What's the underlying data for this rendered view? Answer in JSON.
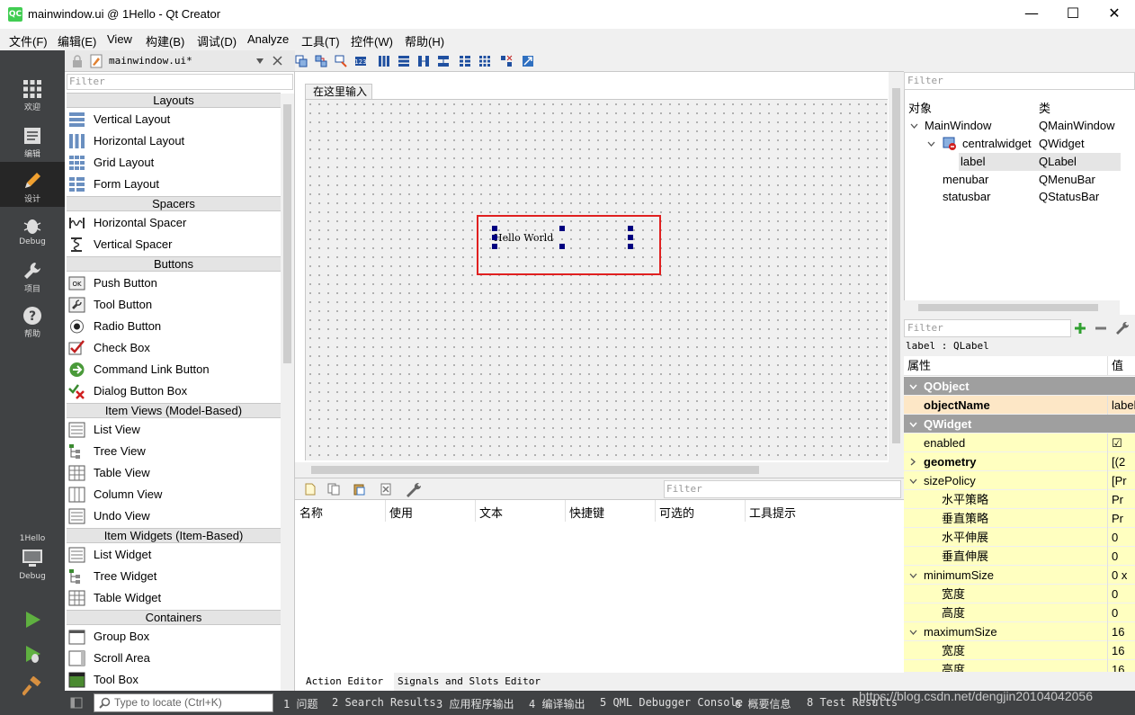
{
  "window": {
    "app_icon": "QC",
    "title": "mainwindow.ui @ 1Hello - Qt Creator",
    "minimize": "—",
    "maximize": "☐",
    "close": "✕"
  },
  "menu": [
    "文件(F)",
    "编辑(E)",
    "View",
    "构建(B)",
    "调试(D)",
    "Analyze",
    "工具(T)",
    "控件(W)",
    "帮助(H)"
  ],
  "modes": [
    {
      "label": "欢迎",
      "icon": "grid-icon"
    },
    {
      "label": "编辑",
      "icon": "document-icon"
    },
    {
      "label": "设计",
      "icon": "pencil-icon"
    },
    {
      "label": "Debug",
      "icon": "bug-icon"
    },
    {
      "label": "项目",
      "icon": "wrench-icon"
    },
    {
      "label": "帮助",
      "icon": "help-icon"
    }
  ],
  "kit": {
    "project": "1Hello",
    "config": "Debug"
  },
  "file_toolbar": {
    "filename": "mainwindow.ui*"
  },
  "widget_box": {
    "filter_placeholder": "Filter",
    "categories": [
      {
        "name": "Layouts",
        "items": [
          "Vertical Layout",
          "Horizontal Layout",
          "Grid Layout",
          "Form Layout"
        ]
      },
      {
        "name": "Spacers",
        "items": [
          "Horizontal Spacer",
          "Vertical Spacer"
        ]
      },
      {
        "name": "Buttons",
        "items": [
          "Push Button",
          "Tool Button",
          "Radio Button",
          "Check Box",
          "Command Link Button",
          "Dialog Button Box"
        ]
      },
      {
        "name": "Item Views (Model-Based)",
        "items": [
          "List View",
          "Tree View",
          "Table View",
          "Column View",
          "Undo View"
        ]
      },
      {
        "name": "Item Widgets (Item-Based)",
        "items": [
          "List Widget",
          "Tree Widget",
          "Table Widget"
        ]
      },
      {
        "name": "Containers",
        "items": [
          "Group Box",
          "Scroll Area",
          "Tool Box"
        ]
      }
    ]
  },
  "form": {
    "menu_placeholder": "在这里输入",
    "label_text": "Hello World"
  },
  "action_editor": {
    "filter_placeholder": "Filter",
    "columns": [
      "名称",
      "使用",
      "文本",
      "快捷键",
      "可选的",
      "工具提示"
    ],
    "tabs": [
      "Action Editor",
      "Signals and Slots Editor"
    ]
  },
  "object_inspector": {
    "filter_placeholder": "Filter",
    "columns": [
      "对象",
      "类"
    ],
    "rows": [
      {
        "name": "MainWindow",
        "class": "QMainWindow"
      },
      {
        "name": "centralwidget",
        "class": "QWidget"
      },
      {
        "name": "label",
        "class": "QLabel"
      },
      {
        "name": "menubar",
        "class": "QMenuBar"
      },
      {
        "name": "statusbar",
        "class": "QStatusBar"
      }
    ]
  },
  "property_editor": {
    "filter_placeholder": "Filter",
    "selected": "label : QLabel",
    "columns": [
      "属性",
      "值"
    ],
    "rows": [
      {
        "name": "QObject",
        "value": ""
      },
      {
        "name": "objectName",
        "value": "label"
      },
      {
        "name": "QWidget",
        "value": ""
      },
      {
        "name": "enabled",
        "value": "☑"
      },
      {
        "name": "geometry",
        "value": "[(2"
      },
      {
        "name": "sizePolicy",
        "value": "[Pr"
      },
      {
        "name": "水平策略",
        "value": "Pr"
      },
      {
        "name": "垂直策略",
        "value": "Pr"
      },
      {
        "name": "水平伸展",
        "value": "0"
      },
      {
        "name": "垂直伸展",
        "value": "0"
      },
      {
        "name": "minimumSize",
        "value": "0 x"
      },
      {
        "name": "宽度",
        "value": "0"
      },
      {
        "name": "高度",
        "value": "0"
      },
      {
        "name": "maximumSize",
        "value": "16"
      },
      {
        "name": "宽度",
        "value": "16"
      },
      {
        "name": "高度",
        "value": "16"
      }
    ]
  },
  "status_bar": {
    "locator_placeholder": "Type to locate (Ctrl+K)",
    "tabs": [
      "1 问题",
      "2 Search Results",
      "3 应用程序输出",
      "4 编译输出",
      "5 QML Debugger Console",
      "6 概要信息",
      "8 Test Results"
    ]
  },
  "watermark": "https://blog.csdn.net/dengjin20104042056"
}
